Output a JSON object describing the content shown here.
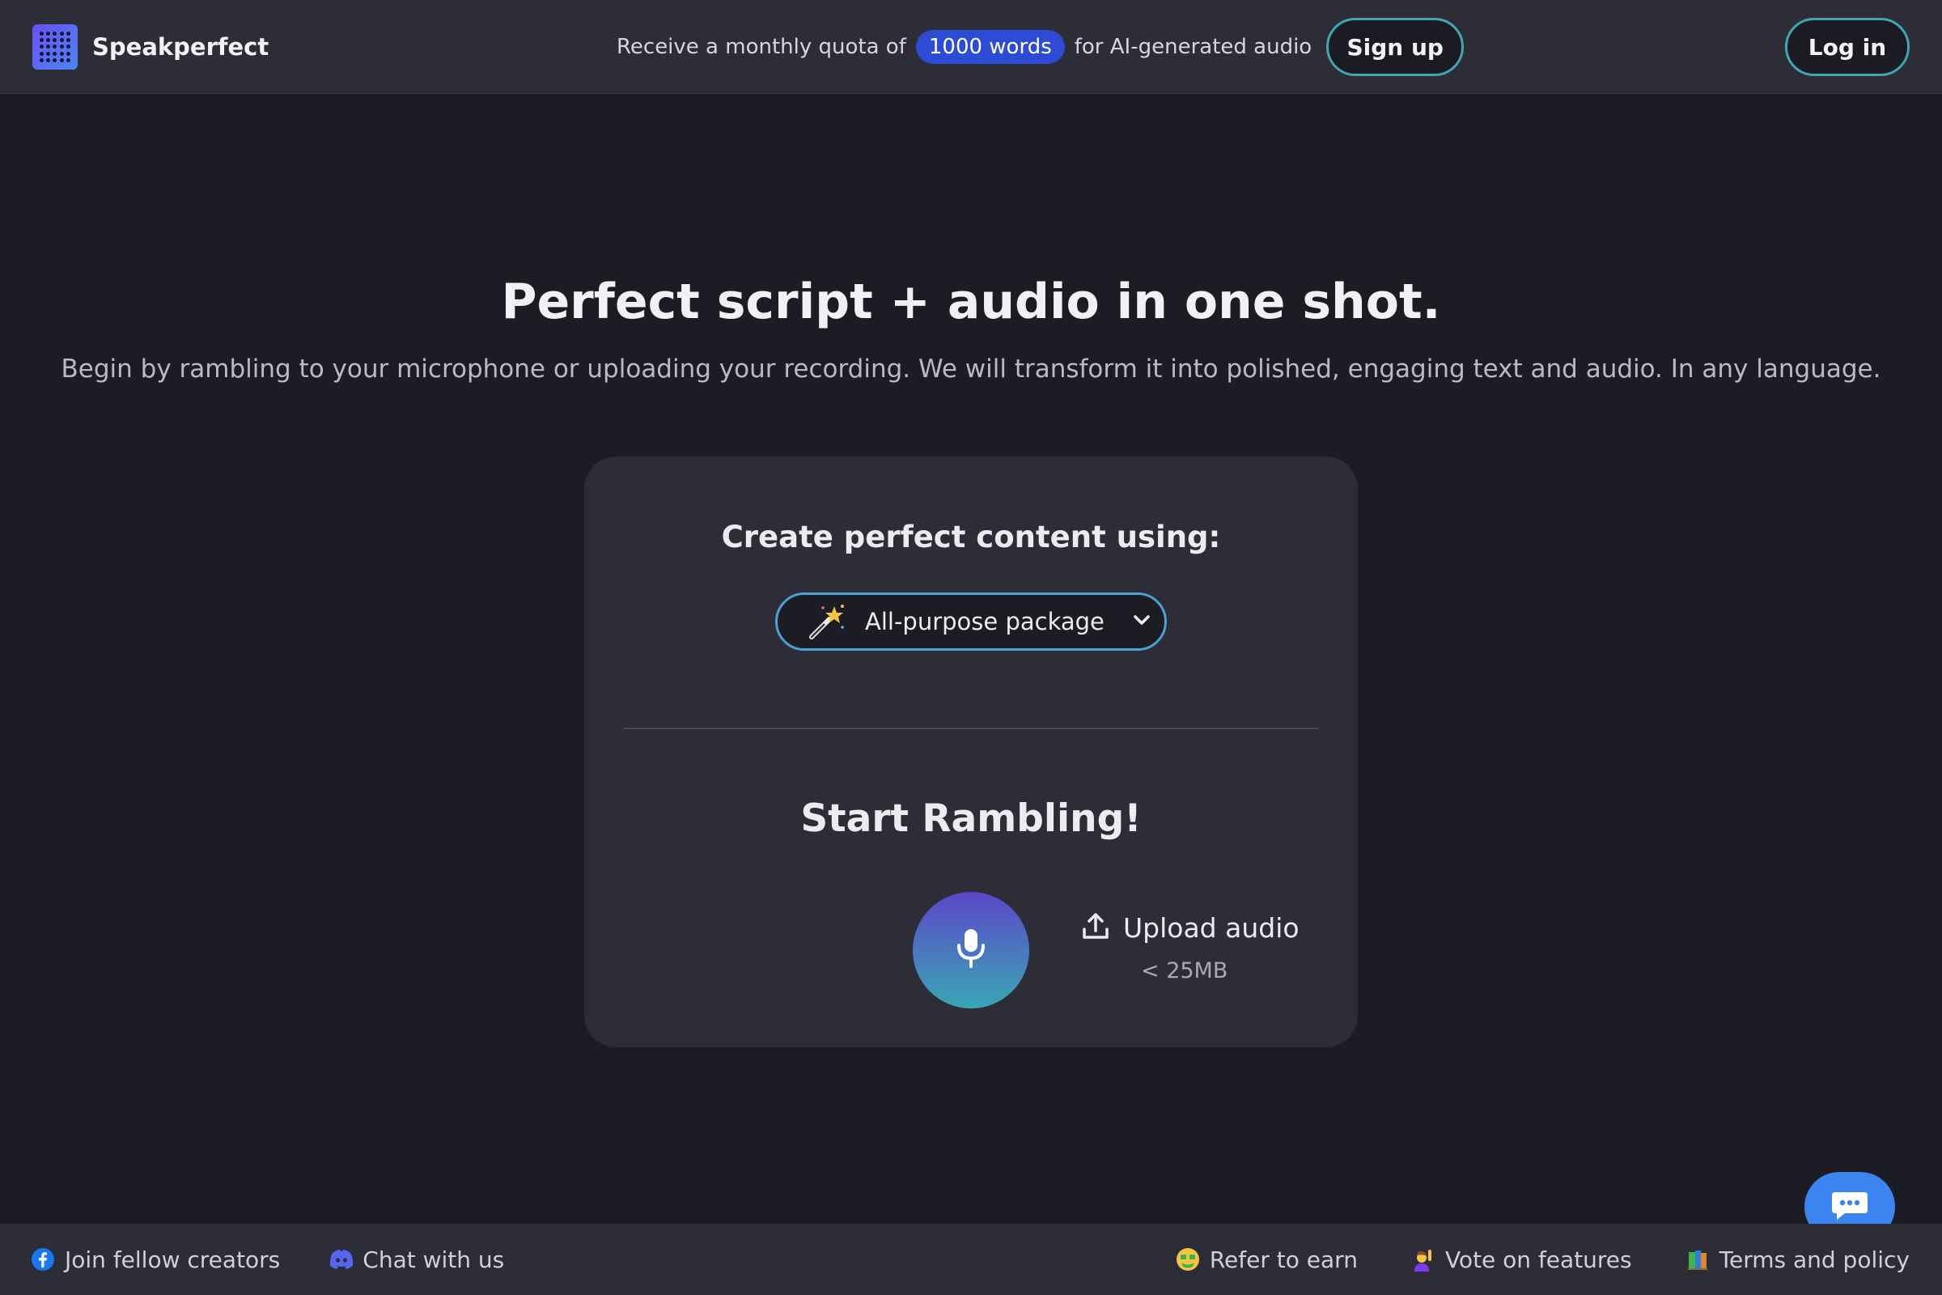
{
  "header": {
    "brand_name": "Speakperfect",
    "promo_prefix": "Receive a monthly quota of",
    "promo_highlight": "1000 words",
    "promo_suffix": "for AI-generated audio",
    "signup_label": "Sign up",
    "login_label": "Log in"
  },
  "hero": {
    "title": "Perfect script + audio in one shot.",
    "subtitle": "Begin by rambling to your microphone or uploading your recording. We will transform it into polished, engaging text and audio. In any language."
  },
  "card": {
    "heading": "Create perfect content using:",
    "package_selected": "All-purpose package",
    "ramble_heading": "Start Rambling!",
    "upload_label": "Upload audio",
    "upload_limit": "< 25MB"
  },
  "footer": {
    "left": [
      {
        "label": "Join fellow creators",
        "icon": "facebook-icon"
      },
      {
        "label": "Chat with us",
        "icon": "discord-icon"
      }
    ],
    "right": [
      {
        "label": "Refer to earn",
        "icon": "money-face-emoji"
      },
      {
        "label": "Vote on features",
        "icon": "raising-hand-emoji"
      },
      {
        "label": "Terms and policy",
        "icon": "books-emoji"
      }
    ]
  },
  "colors": {
    "background": "#1c1c25",
    "panel": "#2c2d37",
    "accent_blue": "#2e4bd6",
    "accent_teal": "#3fa6b5",
    "chat_button": "#3c84f0"
  }
}
